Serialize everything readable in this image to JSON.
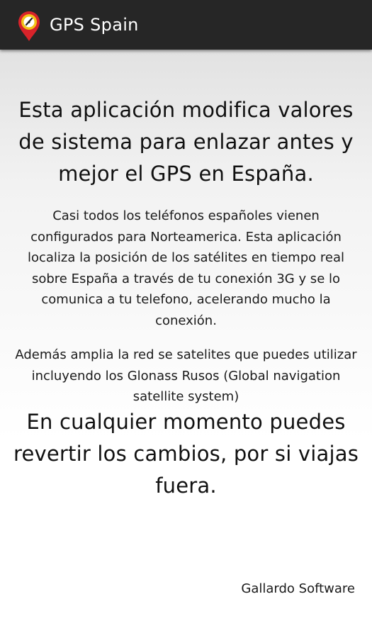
{
  "action_bar": {
    "title": "GPS Spain",
    "icon": "map-pin-gauge-icon"
  },
  "content": {
    "headline_top": "Esta aplicación modifica valores de sistema para enlazar antes y mejor el GPS en España.",
    "paragraph_1": "Casi todos los teléfonos españoles vienen configurados para Norteamerica. Esta aplicación localiza la posición de los satélites en tiempo real sobre España a través de tu conexión 3G y se lo comunica a tu telefono, acelerando mucho la conexión.",
    "paragraph_2": "Además amplia la red se satelites que puedes utilizar incluyendo los Glonass Rusos (Global navigation satellite system)",
    "headline_bottom": "En cualquier momento puedes revertir los cambios, por si viajas fuera.",
    "footer": "Gallardo Software"
  },
  "colors": {
    "action_bar_bg": "#262626",
    "pin_red": "#d8232a",
    "pin_yellow": "#f2c318"
  }
}
